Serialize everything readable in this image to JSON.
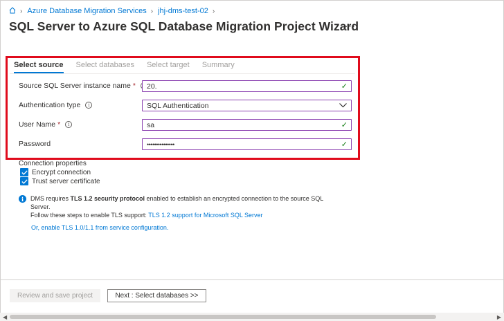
{
  "breadcrumb": {
    "home_icon": "home-icon",
    "items": [
      "Azure Database Migration Services",
      "jhj-dms-test-02"
    ]
  },
  "page": {
    "title": "SQL Server to Azure SQL Database Migration Project Wizard",
    "more_label": "···"
  },
  "tabs": [
    {
      "label": "Select source",
      "active": true
    },
    {
      "label": "Select databases",
      "active": false
    },
    {
      "label": "Select target",
      "active": false
    },
    {
      "label": "Summary",
      "active": false
    }
  ],
  "form": {
    "server_name": {
      "label": "Source SQL Server instance name",
      "required": "*",
      "value": "20."
    },
    "auth_type": {
      "label": "Authentication type",
      "value": "SQL Authentication"
    },
    "user_name": {
      "label": "User Name",
      "required": "*",
      "value": "sa"
    },
    "password": {
      "label": "Password",
      "value": "•••••••••••••••"
    }
  },
  "connection": {
    "title": "Connection properties",
    "encrypt": {
      "label": "Encrypt connection",
      "checked": true
    },
    "trust_cert": {
      "label": "Trust server certificate",
      "checked": true
    }
  },
  "info": {
    "prefix": "DMS requires ",
    "bold": "TLS 1.2 security protocol",
    "suffix": " enabled to establish an encrypted connection to the source SQL Server.",
    "line2": "Follow these steps to enable TLS support: ",
    "link": "TLS 1.2 support for Microsoft SQL Server",
    "enable_link": "Or, enable TLS 1.0/1.1 from service configuration."
  },
  "footer": {
    "review_label": "Review and save project",
    "next_label": "Next : Select databases >>"
  },
  "colors": {
    "accent": "#0078d4",
    "highlight": "#e00b1c",
    "valid": "#107c10",
    "field_border": "#8a3fb0"
  }
}
